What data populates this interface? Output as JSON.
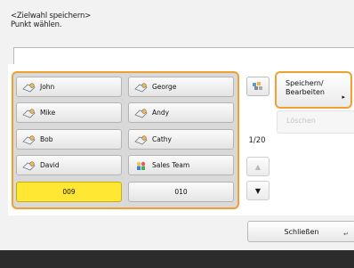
{
  "header": {
    "line1": "<Zielwahl speichern>",
    "line2": "Punkt wählen."
  },
  "name_field": {
    "value": ""
  },
  "grid": {
    "cells": [
      {
        "label": "John",
        "icon": "contact-icon"
      },
      {
        "label": "George",
        "icon": "contact-icon"
      },
      {
        "label": "Mike",
        "icon": "contact-icon"
      },
      {
        "label": "Andy",
        "icon": "contact-icon"
      },
      {
        "label": "Bob",
        "icon": "contact-icon"
      },
      {
        "label": "Cathy",
        "icon": "contact-icon"
      },
      {
        "label": "David",
        "icon": "contact-icon"
      },
      {
        "label": "Sales Team",
        "icon": "group-icon"
      },
      {
        "label": "009",
        "icon": ""
      },
      {
        "label": "010",
        "icon": ""
      }
    ],
    "selected_index": 8
  },
  "side": {
    "page_indicator": "1/20",
    "icon_button": "address-list-icon",
    "up_arrow": "▲",
    "down_arrow": "▼"
  },
  "buttons": {
    "save_line1": "Speichern/",
    "save_line2": "Bearbeiten",
    "save_caret": "▸",
    "delete": "Löschen",
    "close": "Schließen",
    "close_corner": "↵"
  },
  "colors": {
    "focus_border": "#f0a030",
    "selected_cell": "#ffe733",
    "footer_bar": "#2c2c2c"
  }
}
